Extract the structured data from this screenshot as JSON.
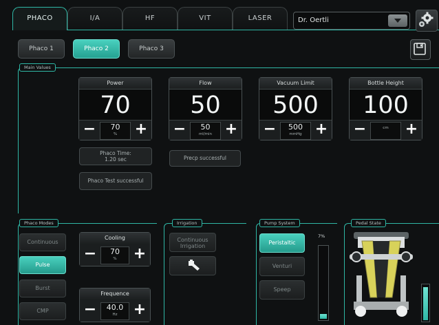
{
  "tabs": [
    {
      "label": "PHACO",
      "active": true
    },
    {
      "label": "I/A"
    },
    {
      "label": "HF"
    },
    {
      "label": "VIT"
    },
    {
      "label": "LASER"
    }
  ],
  "surgeon": {
    "selected": "Dr. Oertli"
  },
  "subtabs": [
    {
      "label": "Phaco 1"
    },
    {
      "label": "Phaco 2",
      "active": true
    },
    {
      "label": "Phaco 3"
    }
  ],
  "main_values": {
    "label": "Main Values",
    "power": {
      "title": "Power",
      "value": "70",
      "set": "70",
      "unit": "%"
    },
    "flow": {
      "title": "Flow",
      "value": "50",
      "set": "50",
      "unit": "ml/min"
    },
    "vacuum": {
      "title": "Vacuum Limit",
      "value": "500",
      "set": "500",
      "unit": "mmHg"
    },
    "bottle": {
      "title": "Bottle Height",
      "value": "100",
      "set": "",
      "unit": "cm"
    }
  },
  "status": {
    "phaco_time": "Phaco Time:",
    "phaco_time_value": "1.20 sec",
    "phaco_test": "Phaco Test successful",
    "precp": "Precp successful"
  },
  "phaco_modes": {
    "label": "Phaco Modes",
    "modes": [
      "Continuous",
      "Pulse",
      "Burst",
      "CMP"
    ],
    "active": "Pulse",
    "cooling": {
      "title": "Cooling",
      "value": "70",
      "unit": "%"
    },
    "frequence": {
      "title": "Frequence",
      "value": "40.0",
      "unit": "Hz"
    }
  },
  "irrigation": {
    "label": "Irrigation",
    "continuous_line1": "Continuous",
    "continuous_line2": "Irrigation"
  },
  "pump": {
    "label": "Pump System",
    "options": [
      "Peristaltic",
      "Venturi",
      "Speep"
    ],
    "active": "Peristaltic",
    "level_text": "7%",
    "level": 0.07
  },
  "pedal": {
    "label": "Pedal State"
  },
  "colors": {
    "accent": "#2fb8a6",
    "active_button": "#3cc1af"
  }
}
